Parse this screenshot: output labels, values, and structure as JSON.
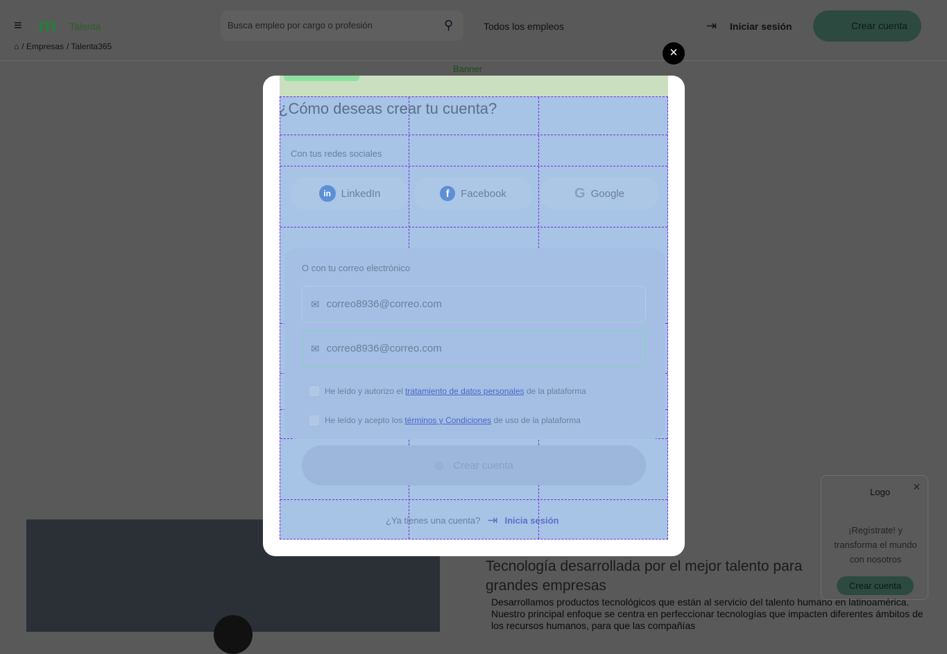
{
  "header": {
    "logo_alt": "Talenta",
    "search_placeholder": "Busca empleo por cargo o profesión",
    "all_jobs": "Todos los empleos",
    "login": "Iniciar sesión",
    "signup": "Crear cuenta"
  },
  "breadcrumb": [
    "/ Empresas",
    "/ Talenta365"
  ],
  "banner_alt": "Banner",
  "content": {
    "heading": "Tecnología desarrollada por el mejor talento para grandes empresas",
    "paragraph": "Desarrollamos productos tecnológicos que están al servicio del talento humano en latinoamérica. Nuestro principal enfoque se centra en perfeccionar tecnologías que impacten diferentes ámbitos de los recursos humanos, para que las compañías"
  },
  "popup": {
    "logo_alt": "Logo",
    "text": "¡Regístrate! y transforma el mundo con nosotros",
    "button": "Crear cuenta"
  },
  "modal": {
    "title": "¿Cómo deseas crear tu cuenta?",
    "social_label": "Con tus redes sociales",
    "social": [
      "LinkedIn",
      "Facebook",
      "Google"
    ],
    "email_label": "O con tu correo electrónico",
    "email_value": "correo8936@correo.com",
    "email_confirm_value": "correo8936@correo.com",
    "check1_pre": "He leído y autorizo el ",
    "check1_link": "tratamiento de datos personales",
    "check1_post": " de la plataforma",
    "check2_pre": "He leído y acepto los ",
    "check2_link": "términos y Condiciones",
    "check2_post": " de uso de la plataforma",
    "submit": "Crear cuenta",
    "have_account": "¿Ya tienes una cuenta?",
    "login_link": "Inicia sesión",
    "close": "×"
  },
  "colors": {
    "accent": "#7fd3b5",
    "overlay_blue": "#a7c3e5"
  }
}
